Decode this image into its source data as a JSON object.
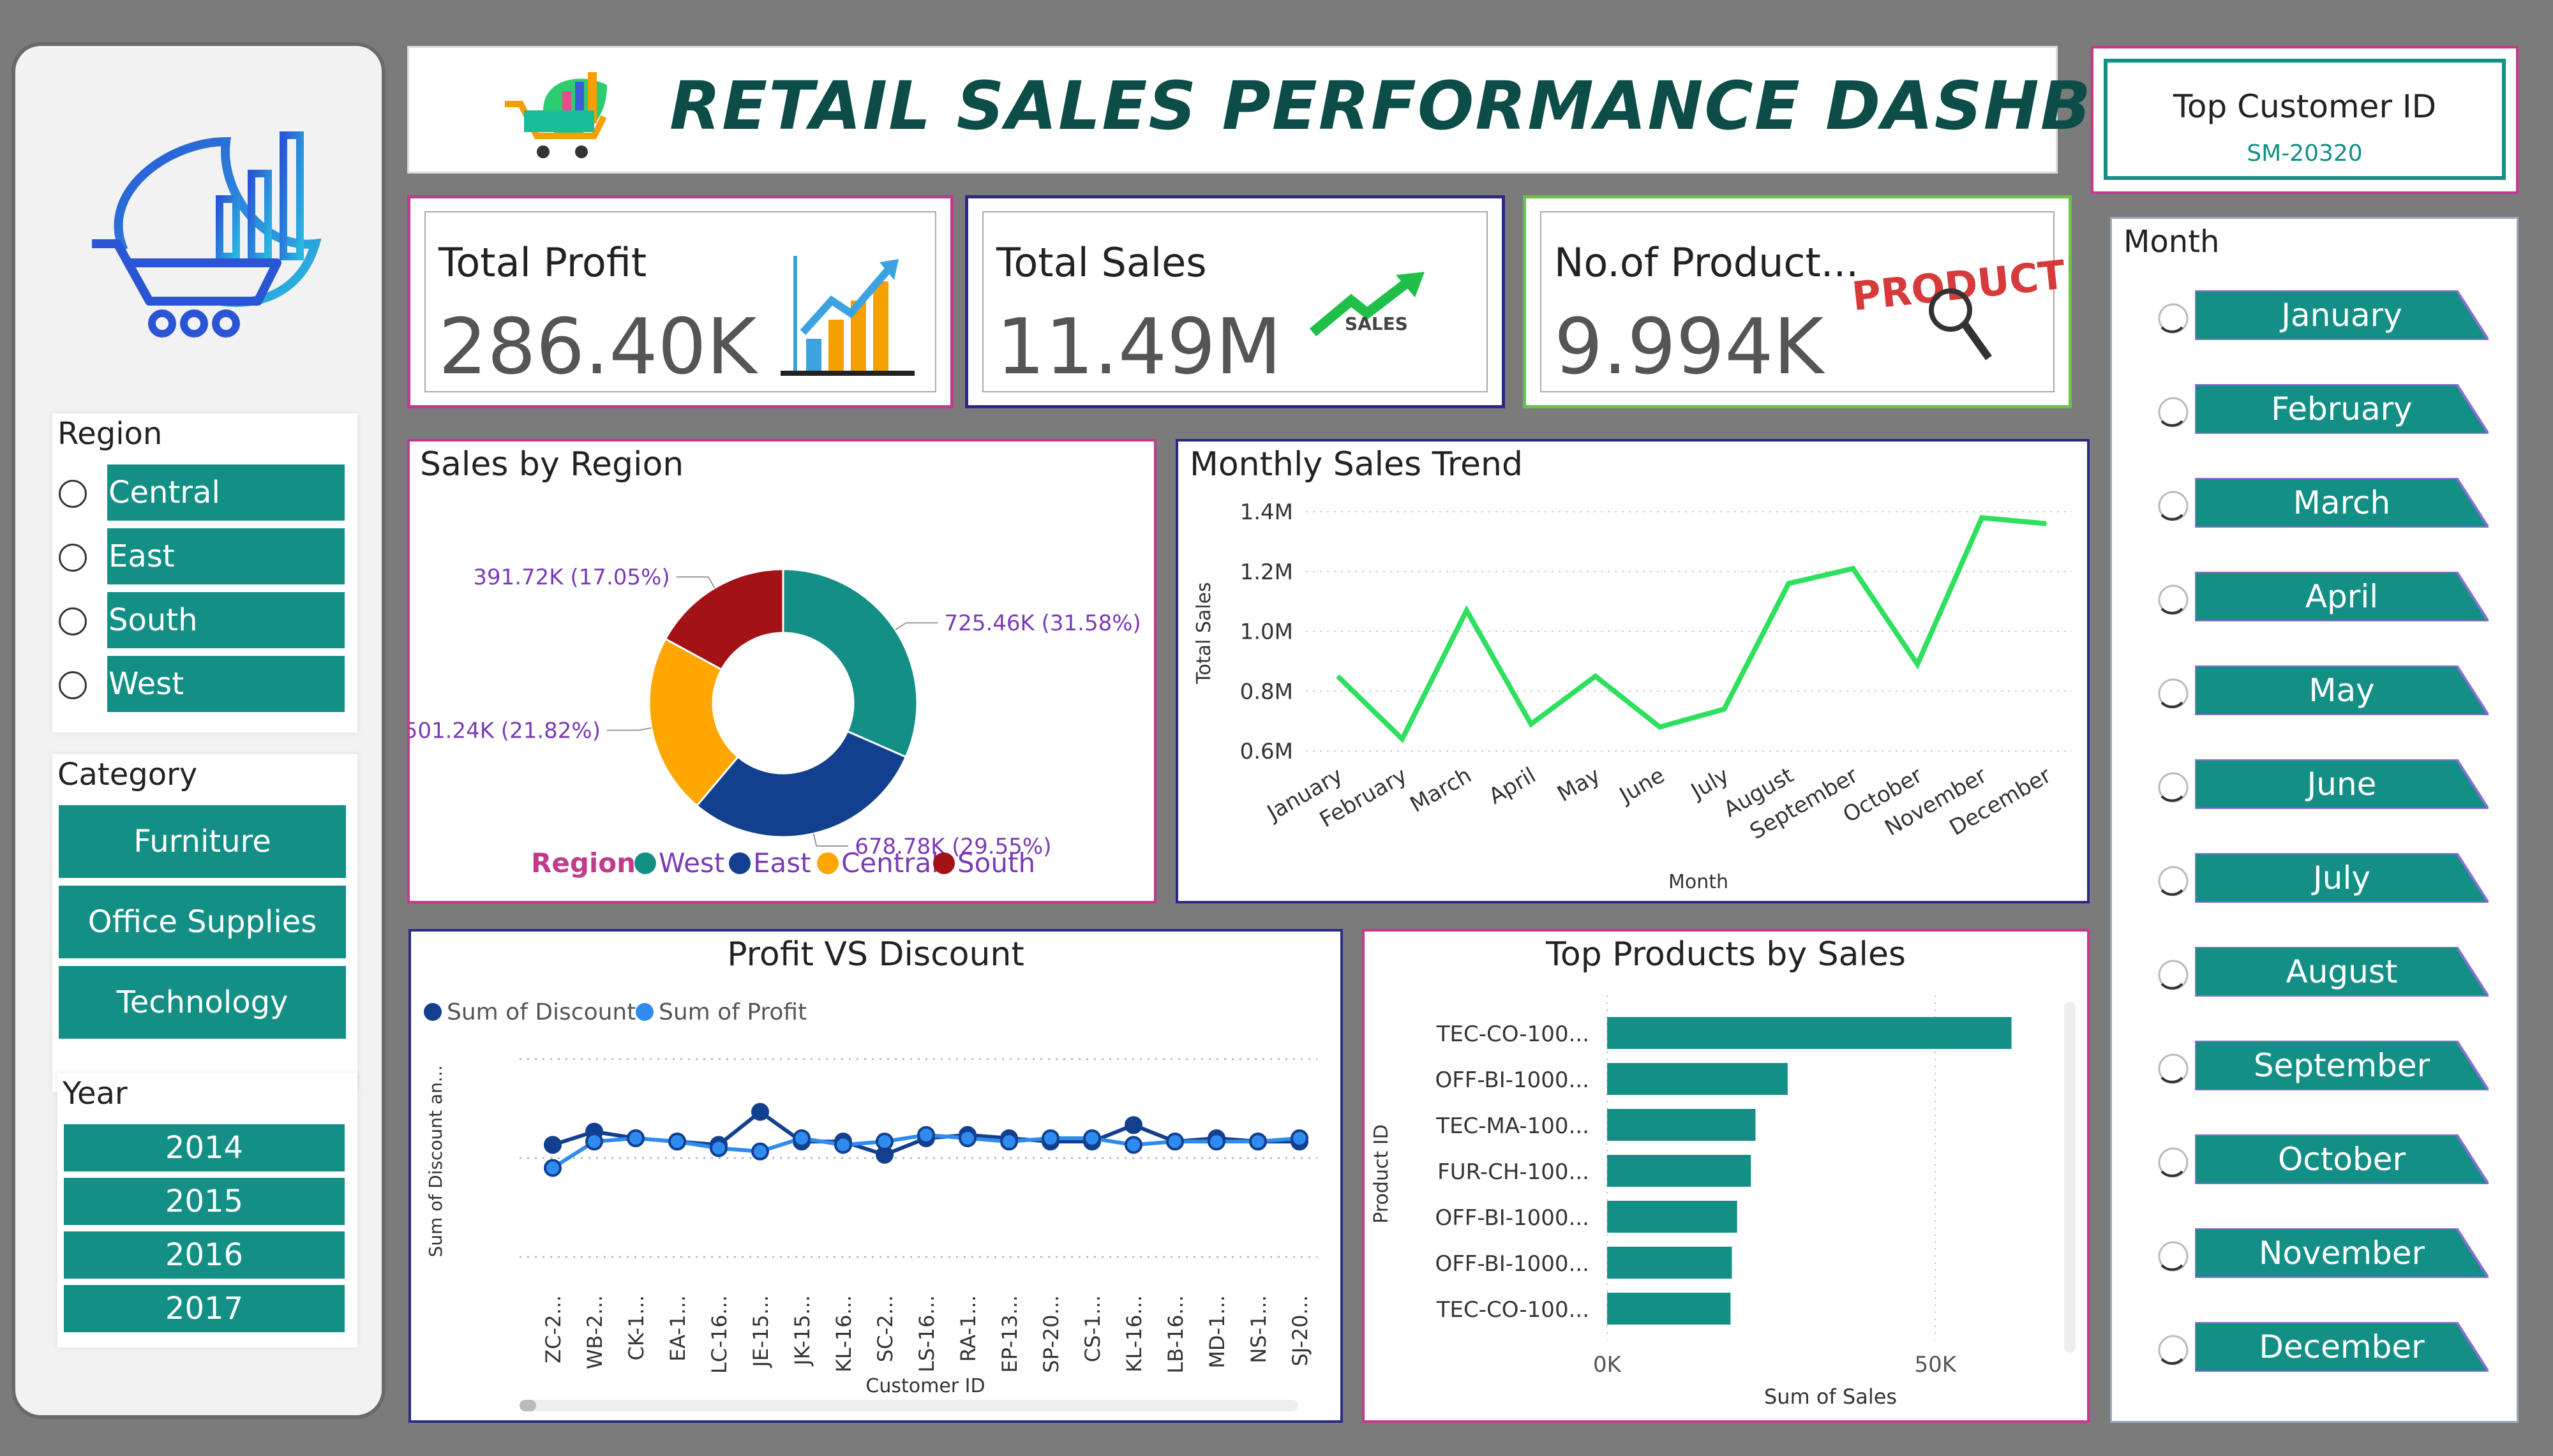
{
  "header": {
    "title": "RETAIL SALES PERFORMANCE DASHBOARD"
  },
  "top_customer": {
    "label": "Top Customer ID",
    "value": "SM-20320"
  },
  "kpis": {
    "profit": {
      "label": "Total Profit",
      "value": "286.40K"
    },
    "sales": {
      "label": "Total Sales",
      "value": "11.49M"
    },
    "products": {
      "label": "No.of Product...",
      "value": "9.994K"
    }
  },
  "kpi_images": {
    "sales_text": "SALES",
    "product_text": "PRODUCT"
  },
  "sidebar": {
    "region": {
      "title": "Region",
      "items": [
        "Central",
        "East",
        "South",
        "West"
      ]
    },
    "category": {
      "title": "Category",
      "items": [
        "Furniture",
        "Office Supplies",
        "Technology"
      ]
    },
    "year": {
      "title": "Year",
      "items": [
        "2014",
        "2015",
        "2016",
        "2017"
      ]
    }
  },
  "month_slicer": {
    "title": "Month",
    "items": [
      "January",
      "February",
      "March",
      "April",
      "May",
      "June",
      "July",
      "August",
      "September",
      "October",
      "November",
      "December"
    ]
  },
  "colors": {
    "teal": "#138f86",
    "header_text": "#0d4d47",
    "west": "#138f86",
    "east": "#12408f",
    "central": "#ffa600",
    "south": "#a31215",
    "line": "#2ee05e",
    "pink": "#c23a8c",
    "navy": "#2a2a86",
    "green": "#6cc04a"
  },
  "chart_data": [
    {
      "type": "pie",
      "title": "Sales by Region",
      "legend_title": "Region",
      "legend_position": "bottom",
      "categories": [
        "West",
        "East",
        "Central",
        "South"
      ],
      "values": [
        725.46,
        678.78,
        501.24,
        391.72
      ],
      "labels": [
        "725.46K (31.58%)",
        "678.78K (29.55%)",
        "501.24K (21.82%)",
        "391.72K (17.05%)"
      ]
    },
    {
      "type": "line",
      "title": "Monthly Sales Trend",
      "xlabel": "Month",
      "ylabel": "Total Sales",
      "x": [
        "January",
        "February",
        "March",
        "April",
        "May",
        "June",
        "July",
        "August",
        "September",
        "October",
        "November",
        "December"
      ],
      "values": [
        0.85,
        0.64,
        1.07,
        0.69,
        0.85,
        0.68,
        0.74,
        1.16,
        1.21,
        0.89,
        1.38,
        1.36
      ],
      "ylim": [
        0.6,
        1.4
      ],
      "yticks": [
        "1.4M",
        "1.2M",
        "1.0M",
        "0.8M",
        "0.6M"
      ],
      "grid": true
    },
    {
      "type": "line",
      "title": "Profit VS Discount",
      "xlabel": "Customer ID",
      "ylabel": "Sum of Discount an...",
      "legend_position": "top-left",
      "x": [
        "ZC-2...",
        "WB-2...",
        "CK-1...",
        "EA-1...",
        "LC-16...",
        "JE-15...",
        "JK-15...",
        "KL-16...",
        "SC-2...",
        "LS-16...",
        "RA-1...",
        "EP-13...",
        "SP-20...",
        "CS-1...",
        "KL-16...",
        "LB-16...",
        "MD-1...",
        "NS-1...",
        "SJ-20..."
      ],
      "series": [
        {
          "name": "Sum of Discount",
          "values": [
            0.4,
            0.8,
            0.6,
            0.5,
            0.4,
            1.4,
            0.5,
            0.5,
            0.1,
            0.6,
            0.7,
            0.6,
            0.5,
            0.5,
            1.0,
            0.5,
            0.6,
            0.5,
            0.5
          ]
        },
        {
          "name": "Sum of Profit",
          "values": [
            -0.3,
            0.5,
            0.6,
            0.5,
            0.3,
            0.2,
            0.6,
            0.4,
            0.5,
            0.7,
            0.6,
            0.5,
            0.6,
            0.6,
            0.4,
            0.5,
            0.5,
            0.5,
            0.6
          ]
        }
      ],
      "ylim": [
        -3,
        3
      ],
      "grid": true
    },
    {
      "type": "bar",
      "orientation": "horizontal",
      "title": "Top Products by Sales",
      "xlabel": "Sum of Sales",
      "ylabel": "Product ID",
      "categories": [
        "TEC-CO-100...",
        "OFF-BI-1000...",
        "TEC-MA-100...",
        "FUR-CH-100...",
        "OFF-BI-1000...",
        "OFF-BI-1000...",
        "TEC-CO-100..."
      ],
      "values": [
        61600,
        27500,
        22600,
        21900,
        19800,
        19000,
        18800
      ],
      "xlim": [
        0,
        70000
      ],
      "xticks": [
        "0K",
        "50K"
      ],
      "grid": true
    }
  ]
}
